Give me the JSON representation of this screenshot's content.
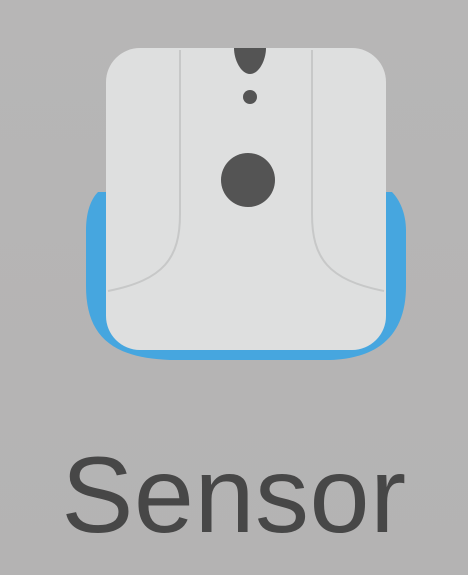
{
  "app": {
    "label": "Sensor",
    "icon": "sensor-device-icon"
  },
  "colors": {
    "background": "#b6b5b5",
    "device_body": "#dedfdf",
    "device_base": "#46a6df",
    "device_dots": "#545454",
    "label_text": "#474747"
  }
}
